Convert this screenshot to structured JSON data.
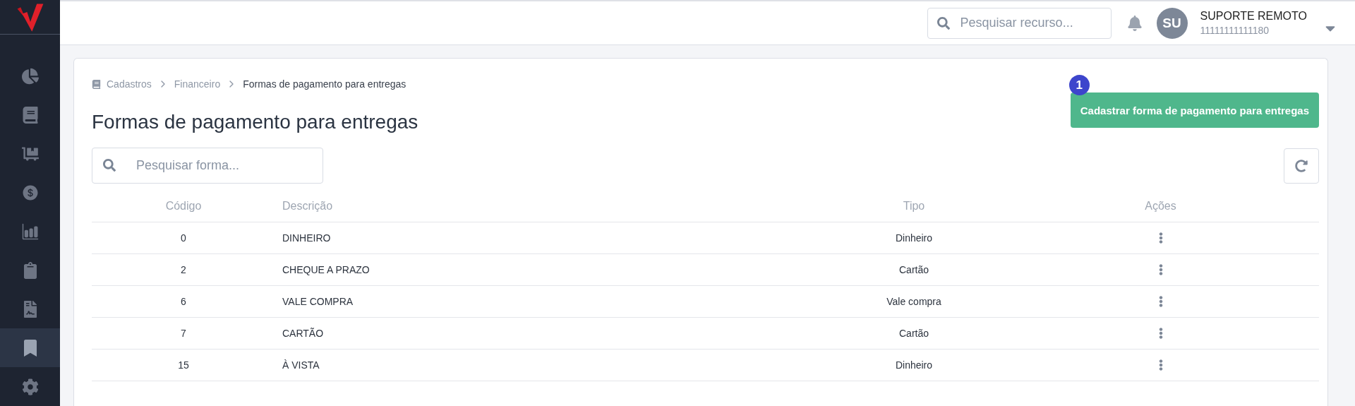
{
  "sidebar": {
    "items": [
      {
        "selected": false
      },
      {
        "selected": false
      },
      {
        "selected": false
      },
      {
        "selected": false
      },
      {
        "selected": false
      },
      {
        "selected": false
      },
      {
        "selected": false
      },
      {
        "selected": true
      },
      {
        "selected": false
      }
    ]
  },
  "header": {
    "search": {
      "placeholder": "Pesquisar recurso..."
    },
    "user": {
      "initials": "SU",
      "name": "SUPORTE REMOTO",
      "id": "11111111111180"
    }
  },
  "breadcrumb": [
    "Cadastros",
    "Financeiro",
    "Formas de pagamento para entregas"
  ],
  "page_title": "Formas de pagamento para entregas",
  "primary_button": {
    "label": "Cadastrar forma de pagamento para entregas",
    "badge": "1"
  },
  "search": {
    "placeholder": "Pesquisar forma..."
  },
  "table": {
    "columns": [
      "Código",
      "Descrição",
      "Tipo",
      "Ações"
    ],
    "rows": [
      {
        "code": "0",
        "description": "DINHEIRO",
        "type": "Dinheiro"
      },
      {
        "code": "2",
        "description": "CHEQUE A PRAZO",
        "type": "Cartão"
      },
      {
        "code": "6",
        "description": "VALE COMPRA",
        "type": "Vale compra"
      },
      {
        "code": "7",
        "description": "CARTÃO",
        "type": "Cartão"
      },
      {
        "code": "15",
        "description": "À VISTA",
        "type": "Dinheiro"
      }
    ]
  }
}
